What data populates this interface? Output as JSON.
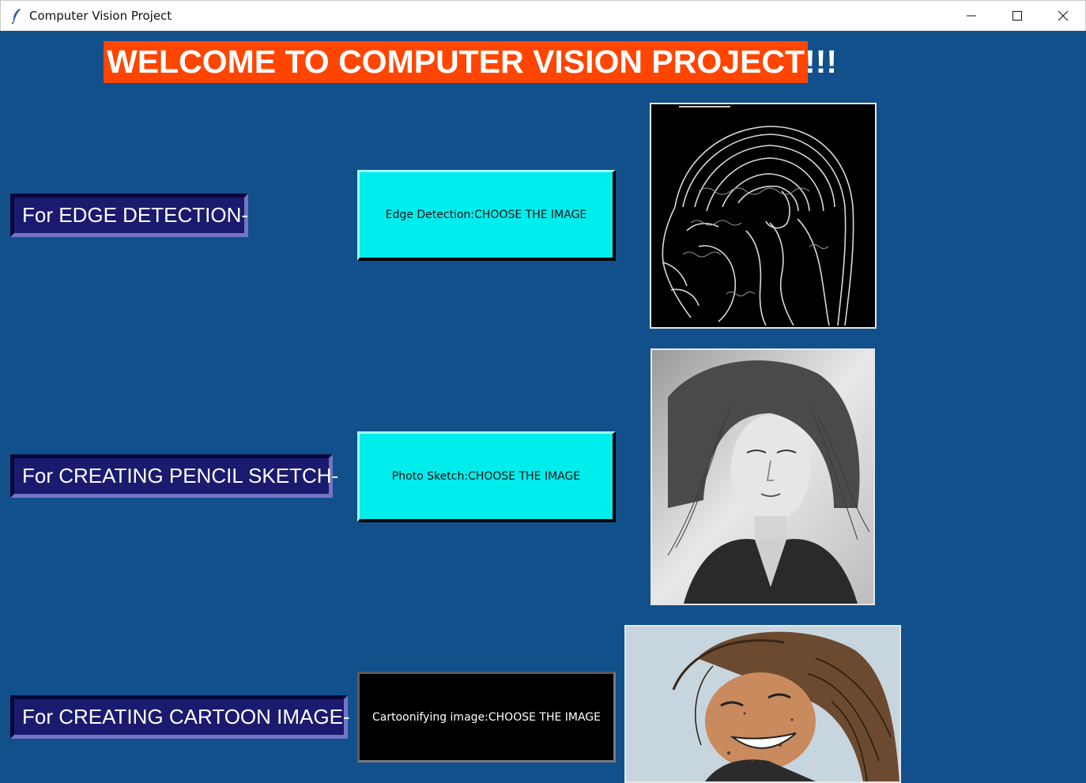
{
  "window": {
    "title": "Computer Vision Project",
    "app_icon": "feather-icon",
    "controls": [
      "minimize-icon",
      "maximize-icon",
      "close-icon"
    ]
  },
  "header": {
    "welcome_text": "WELCOME TO COMPUTER VISION PROJECT!!!"
  },
  "sections": [
    {
      "label": "For EDGE DETECTION-",
      "button": "Edge Detection:CHOOSE THE IMAGE",
      "preview_icon": "edge-detected-brain-image"
    },
    {
      "label": "For CREATING PENCIL SKETCH-",
      "button": "Photo Sketch:CHOOSE THE IMAGE",
      "preview_icon": "pencil-sketch-portrait-image"
    },
    {
      "label": "For CREATING CARTOON IMAGE-",
      "button": "Cartoonifying image:CHOOSE THE IMAGE",
      "preview_icon": "cartoon-portrait-image"
    }
  ],
  "colors": {
    "background": "#12508c",
    "welcome_bg": "#ff4500",
    "label_bg": "#1a1a6e",
    "cyan_button": "#00eded",
    "black_button": "#000000"
  }
}
